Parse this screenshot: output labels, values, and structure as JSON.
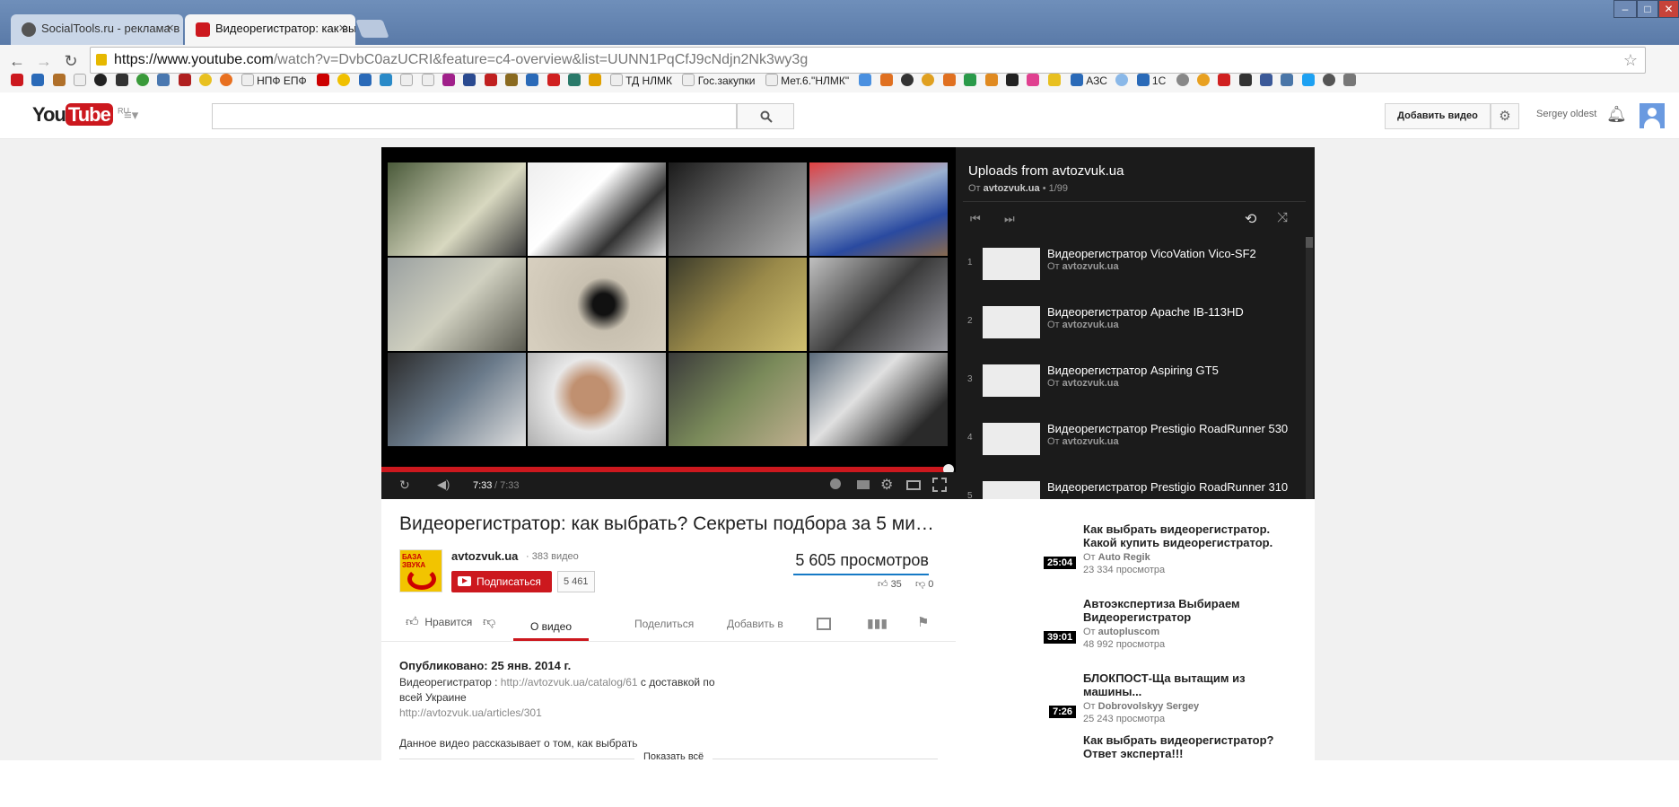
{
  "browser": {
    "tabs": [
      {
        "title": "SocialTools.ru - реклама в",
        "active": false
      },
      {
        "title": "Видеорегистратор: как вы",
        "active": true
      }
    ],
    "url": "https://www.youtube.com/watch?v=DvbC0azUCRI&feature=c4-overview&list=UUNN1PqCfJ9cNdjn2Nk3wy3g",
    "url_host": "https://www.youtube.com",
    "url_path": "/watch?v=DvbC0azUCRI&feature=c4-overview&list=UUNN1PqCfJ9cNdjn2Nk3wy3g",
    "bookmarks": [
      "НПФ ЕПФ",
      "ТД НЛМК",
      "Гос.закупки",
      "Мет.6.\"НЛМК\"",
      "АЗС",
      "1С"
    ]
  },
  "youtube_header": {
    "logo_you": "You",
    "logo_tube": "Tube",
    "region": "RU",
    "upload_label": "Добавить видео",
    "user_name": "Sergey oldest"
  },
  "player": {
    "time_current": "7:33",
    "time_total": "/ 7:33",
    "progress": 1.0
  },
  "playlist": {
    "title": "Uploads from avtozvuk.ua",
    "subtitle_by": "От",
    "subtitle_channel": "avtozvuk.ua",
    "subtitle_pos": "• 1/99",
    "items": [
      {
        "num": "1",
        "title": "Видеорегистратор VicoVation Vico-SF2",
        "by": "От",
        "channel": "avtozvuk.ua"
      },
      {
        "num": "2",
        "title": "Видеорегистратор Apache IB-113HD",
        "by": "От",
        "channel": "avtozvuk.ua"
      },
      {
        "num": "3",
        "title": "Видеорегистратор Aspiring GT5",
        "by": "От",
        "channel": "avtozvuk.ua"
      },
      {
        "num": "4",
        "title": "Видеорегистратор Prestigio RoadRunner 530",
        "by": "От",
        "channel": "avtozvuk.ua"
      },
      {
        "num": "5",
        "title": "Видеорегистратор Prestigio RoadRunner 310",
        "by": "",
        "channel": ""
      }
    ]
  },
  "video": {
    "title": "Видеорегистратор: как выбрать? Секреты подбора за 5 ми…",
    "channel": "avtozvuk.ua",
    "video_count": "· 383 видео",
    "subscribe_label": "Подписаться",
    "subscriber_count": "5 461",
    "views": "5 605 просмотров",
    "likes": "35",
    "dislikes": "0",
    "like_label": "Нравится",
    "tabs": [
      "О видео",
      "Поделиться",
      "Добавить в"
    ],
    "published": "Опубликовано: 25 янв. 2014 г.",
    "desc_line1_prefix": "Видеорегистратор :",
    "desc_link1": "http://avtozvuk.ua/catalog/61",
    "desc_line1_suffix": "с доставкой по",
    "desc_line2": "всей Украине",
    "desc_link2": "http://avtozvuk.ua/articles/301",
    "desc_line3": "Данное видео рассказывает о том, как выбрать",
    "show_more": "Показать всё",
    "logo_text": "БАЗА ЗВУКА"
  },
  "related": [
    {
      "duration": "25:04",
      "title": "Как выбрать видеорегистратор. Какой купить видеорегистратор.",
      "by": "От",
      "channel": "Auto Regik",
      "views": "23 334 просмотра"
    },
    {
      "duration": "39:01",
      "title": "Автоэкспертиза Выбираем Видеорегистратор",
      "by": "От",
      "channel": "autopluscom",
      "views": "48 992 просмотра"
    },
    {
      "duration": "7:26",
      "title": "БЛОКПОСТ-Ща вытащим из машины...",
      "by": "От",
      "channel": "Dobrovolskyy Sergey",
      "views": "25 243 просмотра"
    },
    {
      "duration": "",
      "title": "Как выбрать видеорегистратор? Ответ эксперта!!!",
      "by": "",
      "channel": "",
      "views": ""
    }
  ],
  "colors": {
    "yt_red": "#cc181e",
    "dark": "#1b1b1b",
    "link": "#767676"
  }
}
